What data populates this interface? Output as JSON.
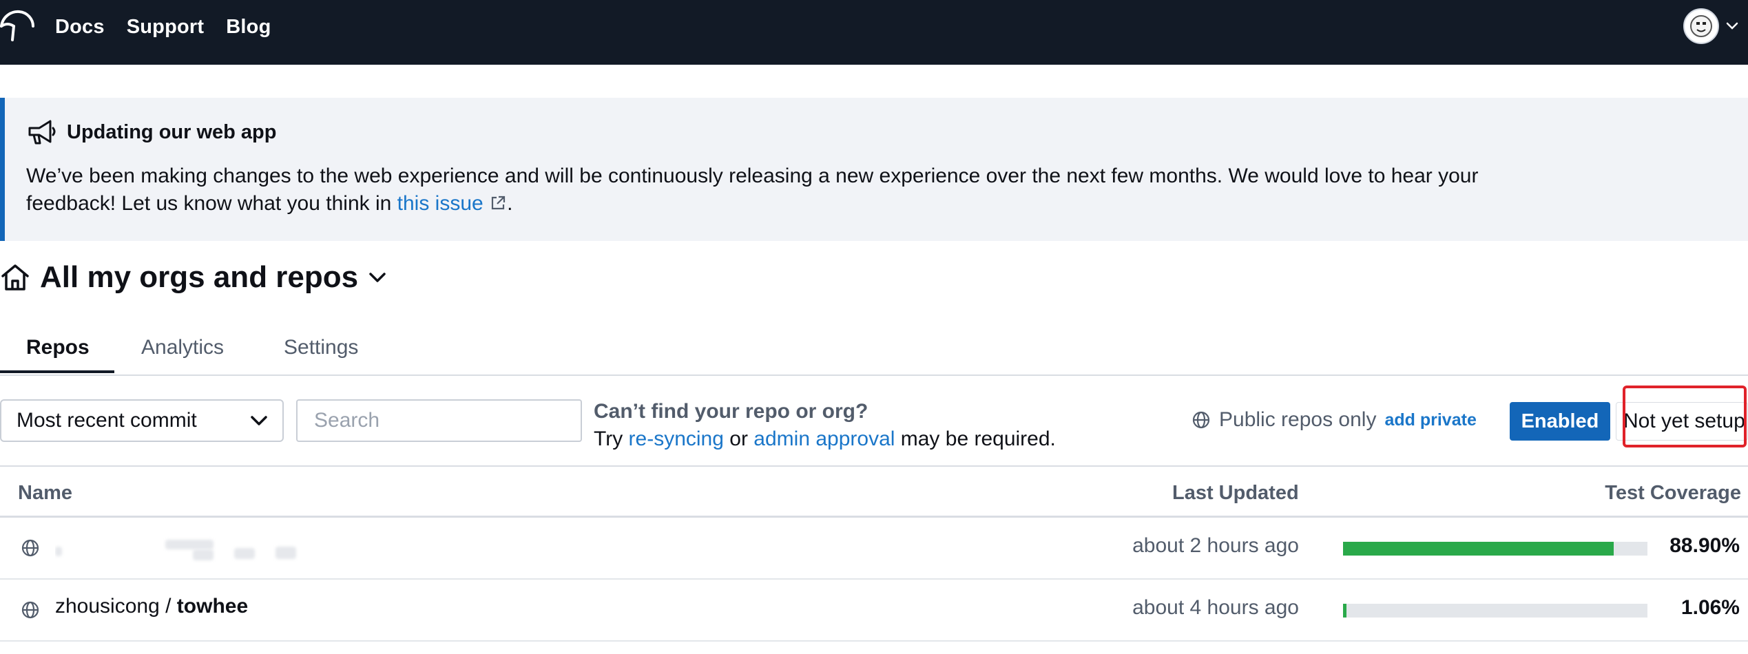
{
  "nav": {
    "links": [
      "Docs",
      "Support",
      "Blog"
    ]
  },
  "banner": {
    "title": "Updating our web app",
    "body_before_link": "We’ve been making changes to the web experience and will be continuously releasing a new experience over the next few months. We would love to hear your feedback! Let us know what you think in ",
    "link_text": "this issue",
    "body_after_link": "."
  },
  "page": {
    "title": "All my orgs and repos"
  },
  "tabs": [
    {
      "label": "Repos",
      "active": true
    },
    {
      "label": "Analytics",
      "active": false
    },
    {
      "label": "Settings",
      "active": false
    }
  ],
  "filters": {
    "sort_value": "Most recent commit",
    "search_placeholder": "Search",
    "cant_find_question": "Can’t find your repo or org?",
    "cant_find_try": "Try ",
    "resync_link": "re-syncing",
    "or_text": " or ",
    "admin_link": "admin approval",
    "required_text": " may be required.",
    "public_only": "Public repos only",
    "add_private": "add private",
    "enabled_label": "Enabled",
    "not_yet_label": "Not yet setup"
  },
  "table": {
    "headers": {
      "name": "Name",
      "last_updated": "Last Updated",
      "coverage": "Test Coverage"
    },
    "rows": [
      {
        "owner": "",
        "repo": "",
        "last_updated": "about 2 hours ago",
        "coverage": "88.90%",
        "coverage_value": 88.9,
        "name_redacted": true
      },
      {
        "owner": "zhousicong",
        "separator": " / ",
        "repo": "towhee",
        "last_updated": "about 4 hours ago",
        "coverage": "1.06%",
        "coverage_value": 1.06,
        "name_redacted": false
      }
    ]
  },
  "colors": {
    "nav_bg": "#121a26",
    "accent": "#1366b8",
    "link": "#1a76c9",
    "coverage_fill": "#2aa94a",
    "highlight": "#e0222a"
  }
}
